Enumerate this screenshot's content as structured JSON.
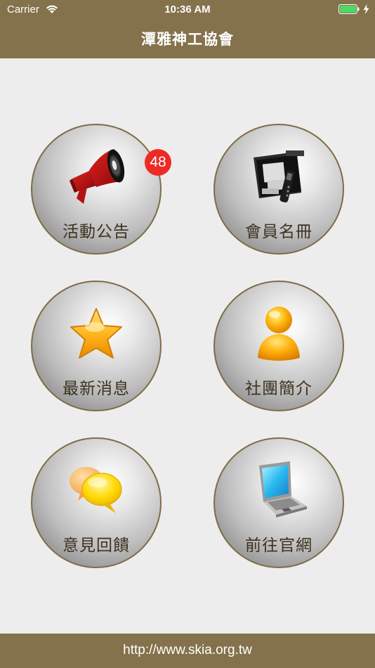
{
  "status_bar": {
    "carrier": "Carrier",
    "time": "10:36 AM"
  },
  "header": {
    "title": "潭雅神工協會"
  },
  "menu": {
    "activities": {
      "label": "活動公告",
      "badge": "48",
      "icon": "megaphone-icon"
    },
    "members": {
      "label": "會員名冊",
      "icon": "directory-folder-icon"
    },
    "news": {
      "label": "最新消息",
      "icon": "star-icon"
    },
    "about": {
      "label": "社團簡介",
      "icon": "person-icon"
    },
    "feedback": {
      "label": "意見回饋",
      "icon": "chat-bubbles-icon"
    },
    "website": {
      "label": "前往官網",
      "icon": "laptop-icon"
    }
  },
  "footer": {
    "url": "http://www.skia.org.tw"
  },
  "colors": {
    "brand": "#84724c",
    "badge": "#ee2a24",
    "background": "#ededed"
  }
}
